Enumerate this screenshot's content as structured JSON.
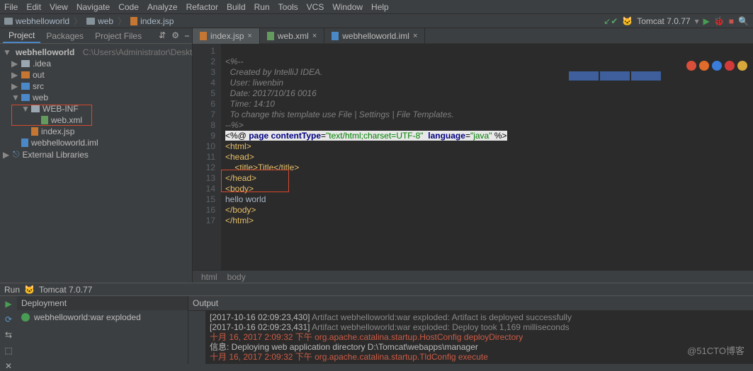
{
  "menu": [
    "File",
    "Edit",
    "View",
    "Navigate",
    "Code",
    "Analyze",
    "Refactor",
    "Build",
    "Run",
    "Tools",
    "VCS",
    "Window",
    "Help"
  ],
  "breadcrumb": {
    "project": "webhelloworld",
    "folder": "web",
    "file": "index.jsp"
  },
  "run_config": "Tomcat 7.0.77",
  "project_panel": {
    "tabs": [
      "Project",
      "Packages",
      "Project Files"
    ],
    "root": "webhelloworld",
    "root_path": "C:\\Users\\Administrator\\Desktop\\webhelloworld",
    "items": [
      {
        "name": ".idea"
      },
      {
        "name": "out"
      },
      {
        "name": "src"
      },
      {
        "name": "web",
        "children": [
          {
            "name": "WEB-INF",
            "children": [
              {
                "name": "web.xml"
              }
            ]
          },
          {
            "name": "index.jsp"
          }
        ]
      },
      {
        "name": "webhelloworld.iml"
      }
    ],
    "external": "External Libraries"
  },
  "editor_tabs": [
    {
      "label": "index.jsp",
      "active": true
    },
    {
      "label": "web.xml"
    },
    {
      "label": "webhelloworld.iml"
    }
  ],
  "code": {
    "lines": [
      "1",
      "2",
      "3",
      "4",
      "5",
      "6",
      "7",
      "8",
      "9",
      "10",
      "11",
      "12",
      "13",
      "14",
      "15",
      "16",
      "17"
    ],
    "c1": "<%--",
    "c2": "  Created by IntelliJ IDEA.",
    "c3": "  User: liwenbin",
    "c4": "  Date: 2017/10/16 0016",
    "c5": "  Time: 14:10",
    "c6": "  To change this template use File | Settings | File Templates.",
    "c7": "--%>",
    "jsp_open": "<%@ ",
    "jsp_page": "page",
    "jsp_ct": " contentType",
    "jsp_eq1": "=",
    "jsp_ctv": "\"text/html;charset=UTF-8\"",
    "jsp_lang": " language",
    "jsp_eq2": "=",
    "jsp_langv": "\"java\"",
    "jsp_close": " %>",
    "t_html_o": "<html>",
    "t_head_o": "<head>",
    "t_title": "    <title>Title</title>",
    "t_head_c": "</head>",
    "t_body_o": "<body>",
    "t_hello": "hello world",
    "t_body_c": "</body>",
    "t_html_c": "</html>",
    "crumbs": [
      "html",
      "body"
    ]
  },
  "run_row": {
    "label": "Run",
    "config": "Tomcat 7.0.77"
  },
  "deployment": {
    "header": "Deployment",
    "artifact": "webhelloworld:war exploded"
  },
  "output": {
    "header": "Output",
    "lines": [
      {
        "ts": "[2017-10-16 02:09:23,430]",
        "msg": " Artifact webhelloworld:war exploded: Artifact is deployed successfully",
        "cls": "log-gray"
      },
      {
        "ts": "[2017-10-16 02:09:23,431]",
        "msg": " Artifact webhelloworld:war exploded: Deploy took 1,169 milliseconds",
        "cls": "log-gray"
      },
      {
        "ts": "十月 16, 2017 2:09:32 下午",
        "msg": " org.apache.catalina.startup.HostConfig deployDirectory",
        "cls": "log-red"
      },
      {
        "ts": "信息:",
        "msg": " Deploying web application directory D:\\Tomcat\\webapps\\manager",
        "cls": "log-info"
      },
      {
        "ts": "十月 16, 2017 2:09:32 下午",
        "msg": " org.apache.catalina.startup.TldConfig execute",
        "cls": "log-red"
      }
    ]
  },
  "watermark": "@51CTO博客"
}
